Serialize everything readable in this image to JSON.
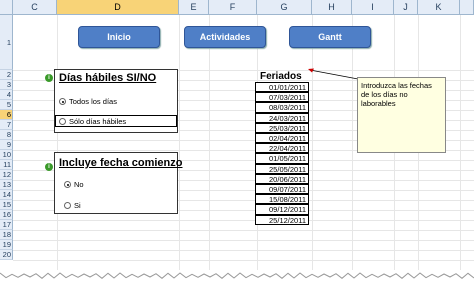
{
  "columns": [
    "C",
    "D",
    "E",
    "F",
    "G",
    "H",
    "I",
    "J",
    "K"
  ],
  "selected_column": "D",
  "rows": [
    "1",
    "2",
    "3",
    "4",
    "5",
    "6",
    "7",
    "8",
    "9",
    "10",
    "11",
    "12",
    "13",
    "14",
    "15",
    "16",
    "17",
    "18",
    "19",
    "20"
  ],
  "selected_row": "6",
  "nav": {
    "inicio": "Inicio",
    "actividades": "Actividades",
    "gantt": "Gantt"
  },
  "group_dias": {
    "title": "Días hábiles SI/NO",
    "option1": "Todos los días",
    "option2": "Sólo días hábiles",
    "selected": "option1"
  },
  "group_fecha": {
    "title": "Incluye fecha comienzo",
    "option1": "No",
    "option2": "Si",
    "selected": "option1"
  },
  "feriados": {
    "title": "Feriados",
    "dates": [
      "01/01/2011",
      "07/03/2011",
      "08/03/2011",
      "24/03/2011",
      "25/03/2011",
      "02/04/2011",
      "22/04/2011",
      "01/05/2011",
      "25/05/2011",
      "20/06/2011",
      "09/07/2011",
      "15/08/2011",
      "09/12/2011",
      "25/12/2011"
    ]
  },
  "comment": {
    "text": "Introduzca las fechas de los días no laborables"
  },
  "colors": {
    "nav_button": "#4f7fc7",
    "header_bg": "#e4ecf7",
    "header_selected": "#f8d377",
    "comment_bg": "#ffffe1",
    "info_icon": "#3a9a2a"
  }
}
